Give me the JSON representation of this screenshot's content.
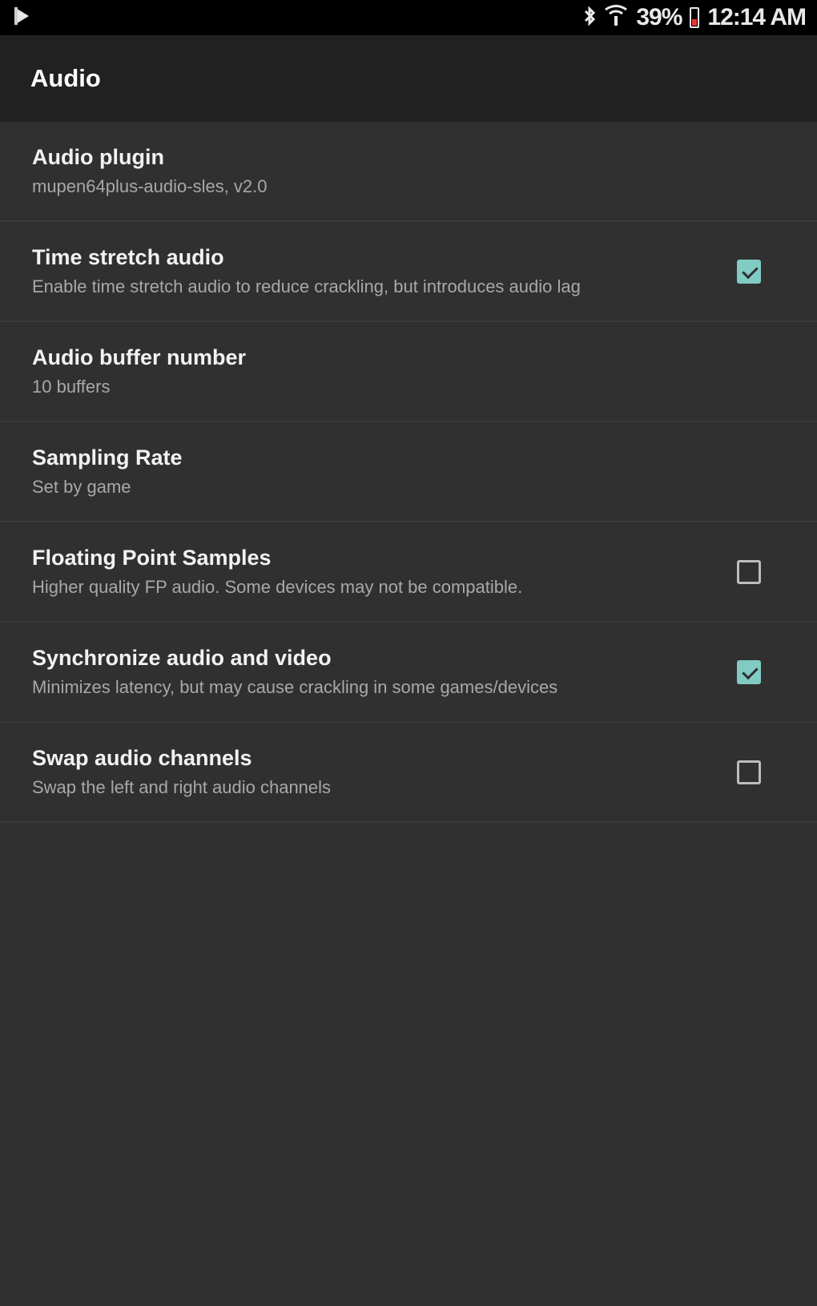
{
  "status_bar": {
    "battery_percent": "39%",
    "time": "12:14 AM",
    "icons": [
      "play-store-icon",
      "bluetooth-icon",
      "wifi-icon",
      "battery-icon"
    ]
  },
  "app_bar": {
    "title": "Audio"
  },
  "settings": [
    {
      "title": "Audio plugin",
      "summary": "mupen64plus-audio-sles, v2.0",
      "control": "none"
    },
    {
      "title": "Time stretch audio",
      "summary": "Enable time stretch audio to reduce crackling, but introduces audio lag",
      "control": "checkbox",
      "checked": true
    },
    {
      "title": "Audio buffer number",
      "summary": "10 buffers",
      "control": "none"
    },
    {
      "title": "Sampling Rate",
      "summary": "Set by game",
      "control": "none"
    },
    {
      "title": "Floating Point Samples",
      "summary": "Higher quality FP audio. Some devices may not be compatible.",
      "control": "checkbox",
      "checked": false
    },
    {
      "title": "Synchronize audio and video",
      "summary": "Minimizes latency, but may cause crackling in some games/devices",
      "control": "checkbox",
      "checked": true
    },
    {
      "title": "Swap audio channels",
      "summary": "Swap the left and right audio channels",
      "control": "checkbox",
      "checked": false
    }
  ],
  "colors": {
    "background": "#303030",
    "app_bar": "#212121",
    "status_bar": "#000000",
    "accent": "#80cbc4"
  }
}
